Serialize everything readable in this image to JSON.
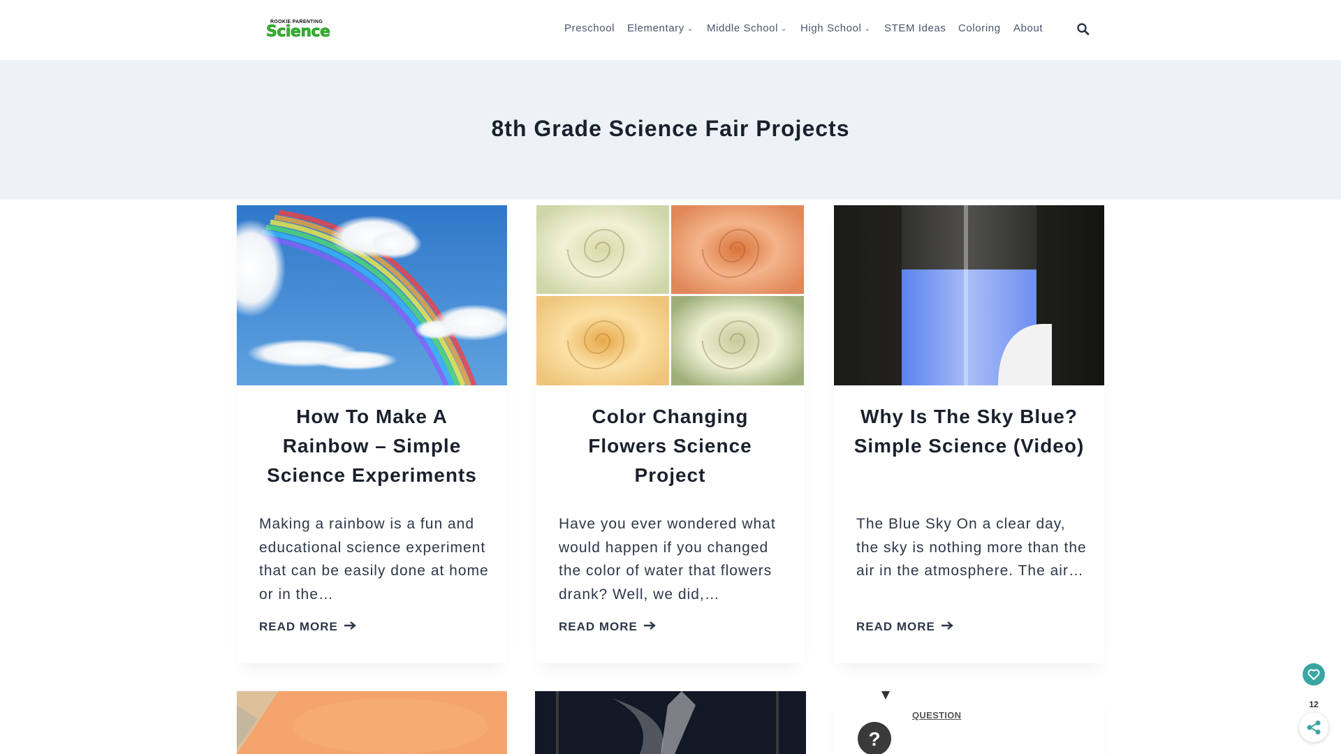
{
  "header": {
    "logo_top": "ROOKIE PARENTING",
    "logo_main": "Science",
    "nav": [
      {
        "label": "Preschool",
        "dropdown": false
      },
      {
        "label": "Elementary",
        "dropdown": true
      },
      {
        "label": "Middle School",
        "dropdown": true
      },
      {
        "label": "High School",
        "dropdown": true
      },
      {
        "label": "STEM Ideas",
        "dropdown": false
      },
      {
        "label": "Coloring",
        "dropdown": false
      },
      {
        "label": "About",
        "dropdown": false
      }
    ],
    "search_icon": "search-icon"
  },
  "hero": {
    "title": "8th Grade Science Fair Projects"
  },
  "posts": [
    {
      "title": "How To Make A Rainbow – Simple Science Experiments",
      "excerpt": "Making a rainbow is a fun and educational science experiment that can be easily done at home or in the…",
      "read_more": "READ MORE",
      "image": "rainbow-sky"
    },
    {
      "title": "Color Changing Flowers Science Project",
      "excerpt": "Have you ever wondered what would happen if you changed the color of water that flowers drank? Well, we did,…",
      "read_more": "READ MORE",
      "image": "four-roses"
    },
    {
      "title": "Why Is The Sky Blue? Simple Science (Video)",
      "excerpt": "The Blue Sky On a clear day, the sky is nothing more than the air in the atmosphere. The air…",
      "read_more": "READ MORE",
      "image": "blue-liquid-glass"
    }
  ],
  "row2": {
    "question_label": "QUESTION"
  },
  "floating": {
    "share_count": "12",
    "fav_icon": "heart-icon",
    "share_icon": "share-icon"
  },
  "colors": {
    "accent": "#3aa6a2",
    "hero_bg": "#edf2f7",
    "logo_green": "#2fb52a"
  }
}
